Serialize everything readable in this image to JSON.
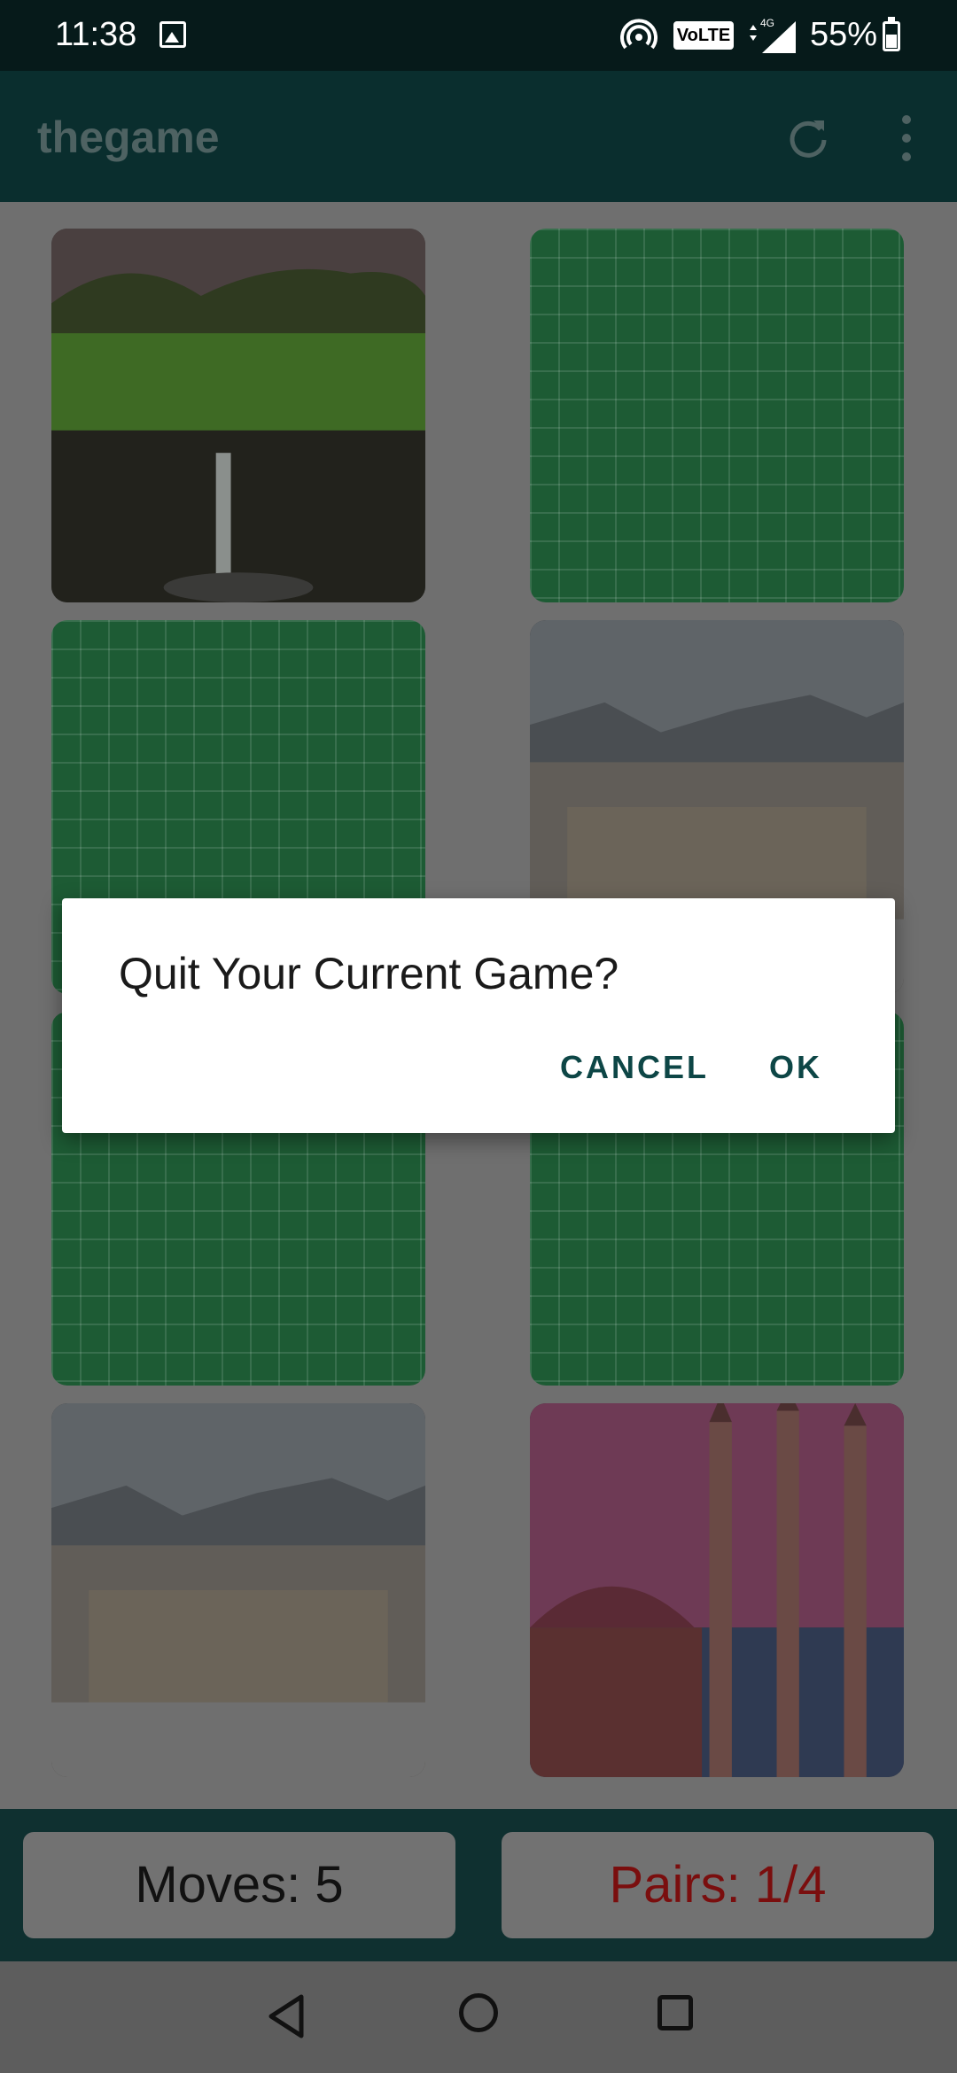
{
  "status_bar": {
    "time": "11:38",
    "network_badge": "VoLTE",
    "network_type": "4G",
    "battery": "55%"
  },
  "app_bar": {
    "title": "thegame",
    "icons": [
      "refresh-icon",
      "more-vertical-icon"
    ]
  },
  "cards": [
    {
      "state": "revealed",
      "image": "waterfall"
    },
    {
      "state": "hidden"
    },
    {
      "state": "hidden"
    },
    {
      "state": "revealed",
      "image": "snowy-town"
    },
    {
      "state": "hidden"
    },
    {
      "state": "hidden"
    },
    {
      "state": "revealed",
      "image": "snowy-town"
    },
    {
      "state": "revealed",
      "image": "mosque"
    }
  ],
  "stats": {
    "moves": "Moves: 5",
    "pairs": "Pairs: 1/4"
  },
  "dialog": {
    "title": "Quit Your Current Game?",
    "cancel_label": "CANCEL",
    "ok_label": "OK"
  },
  "nav_bar": {
    "icons": [
      "back-icon",
      "home-icon",
      "recents-icon"
    ]
  },
  "colors": {
    "app_bar": "#0a2e2e",
    "card_back": "#1d5b34",
    "accent": "#0d4646",
    "pairs_text": "#7a0e0e"
  }
}
